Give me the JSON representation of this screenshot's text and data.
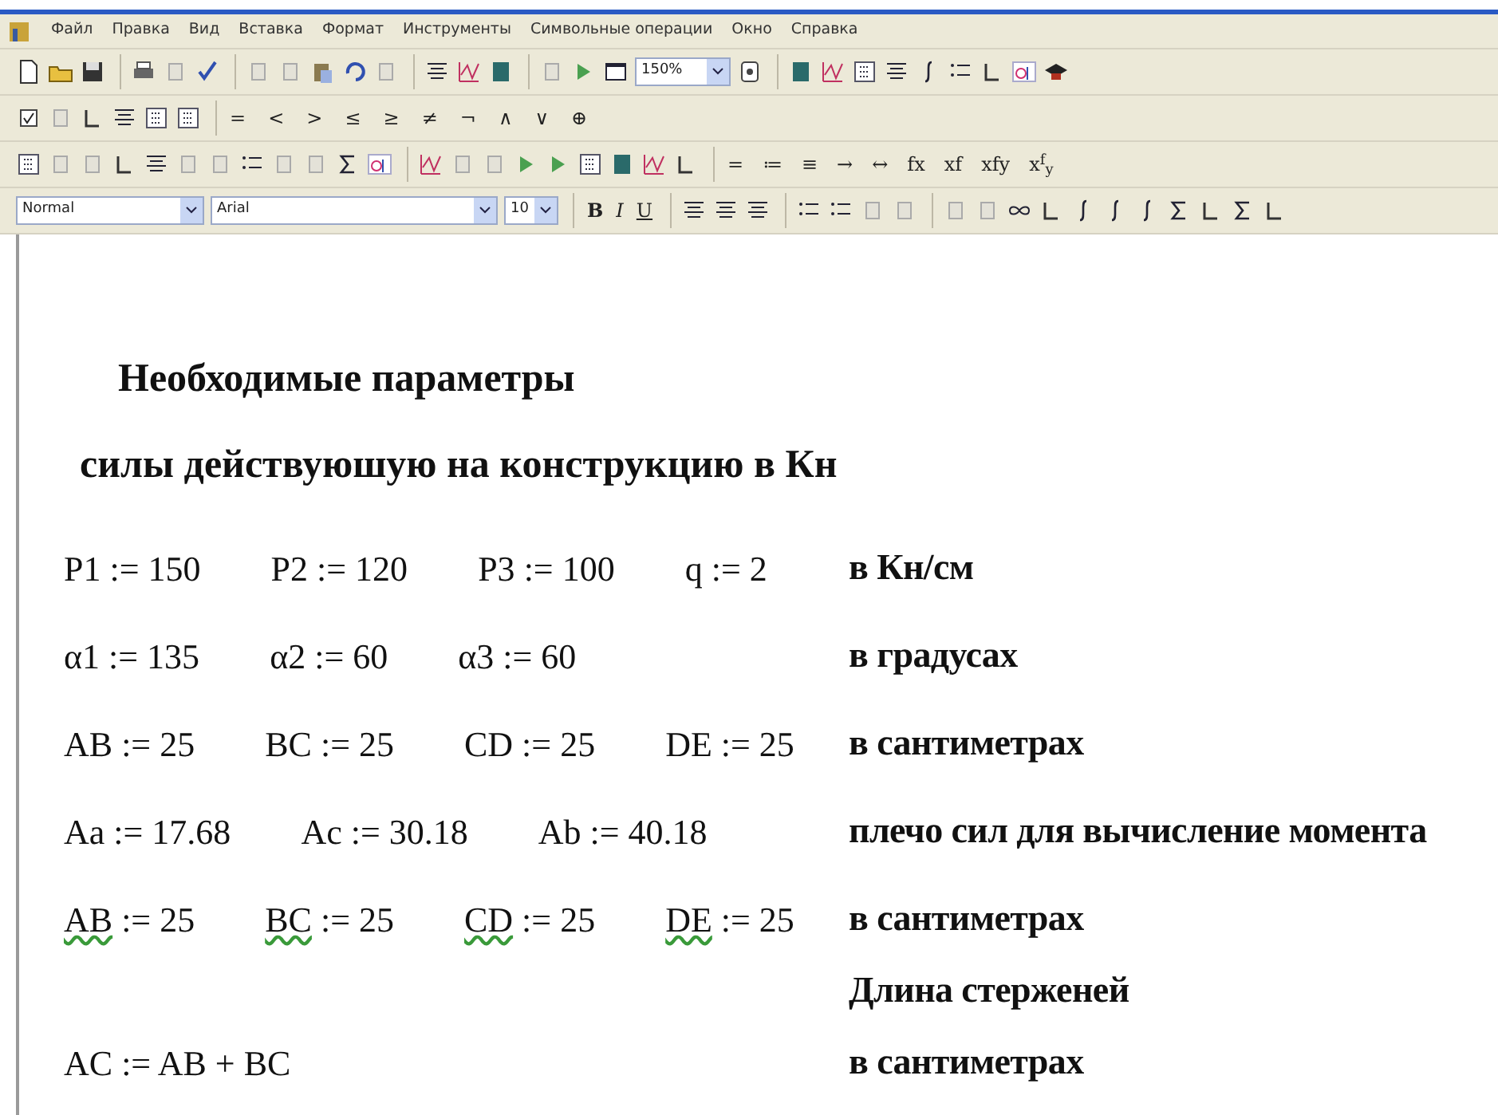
{
  "menu": [
    "Файл",
    "Правка",
    "Вид",
    "Вставка",
    "Формат",
    "Инструменты",
    "Символьные операции",
    "Окно",
    "Справка"
  ],
  "standard_toolbar": {
    "zoom": "150%"
  },
  "boolean_toolbar": [
    "=",
    "<",
    ">",
    "≤",
    "≥",
    "≠",
    "¬",
    "∧",
    "∨",
    "⊕"
  ],
  "evaluation_toolbar": [
    "=",
    "≔",
    "≡",
    "→",
    "↔",
    "fx",
    "xf",
    "xfy",
    "x$^{f}$$_{y}$"
  ],
  "formatting_toolbar": {
    "style": "Normal",
    "font": "Arial",
    "size": "10",
    "text_buttons": [
      "B",
      "I",
      "U"
    ]
  },
  "worksheet": {
    "headings": [
      "Необходимые параметры",
      "силы действуюшую на конструкцию в Кн"
    ],
    "lines": [
      {
        "defs": [
          {
            "name": "P1",
            "op": ":=",
            "value": "150",
            "flagged": false
          },
          {
            "name": "P2",
            "op": ":=",
            "value": "120",
            "flagged": false
          },
          {
            "name": "P3",
            "op": ":=",
            "value": "100",
            "flagged": false
          },
          {
            "name": "q",
            "op": ":=",
            "value": "2",
            "flagged": false
          }
        ],
        "note": "в Кн/см"
      },
      {
        "defs": [
          {
            "name": "α1",
            "op": ":=",
            "value": "135",
            "flagged": false
          },
          {
            "name": "α2",
            "op": ":=",
            "value": "60",
            "flagged": false
          },
          {
            "name": "α3",
            "op": ":=",
            "value": "60",
            "flagged": false
          }
        ],
        "note": "в градусах"
      },
      {
        "defs": [
          {
            "name": "AB",
            "op": ":=",
            "value": "25",
            "flagged": false
          },
          {
            "name": "BC",
            "op": ":=",
            "value": "25",
            "flagged": false
          },
          {
            "name": "CD",
            "op": ":=",
            "value": "25",
            "flagged": false
          },
          {
            "name": "DE",
            "op": ":=",
            "value": "25",
            "flagged": false
          }
        ],
        "note": "в сантиметрах"
      },
      {
        "defs": [
          {
            "name": "Aa",
            "op": ":=",
            "value": "17.68",
            "flagged": false
          },
          {
            "name": "Ac",
            "op": ":=",
            "value": "30.18",
            "flagged": false
          },
          {
            "name": "Ab",
            "op": ":=",
            "value": "40.18",
            "flagged": false
          }
        ],
        "note": "плечо сил для вычисление момента"
      },
      {
        "defs": [
          {
            "name": "AB",
            "op": ":=",
            "value": "25",
            "flagged": true
          },
          {
            "name": "BC",
            "op": ":=",
            "value": "25",
            "flagged": true
          },
          {
            "name": "CD",
            "op": ":=",
            "value": "25",
            "flagged": true
          },
          {
            "name": "DE",
            "op": ":=",
            "value": "25",
            "flagged": true
          }
        ],
        "note": "в сантиметрах"
      },
      {
        "note": "Длина стерженей"
      },
      {
        "defs": [
          {
            "name": "AC",
            "op": ":=",
            "value": "AB + BC",
            "flagged": false
          }
        ],
        "note": "в сантиметрах"
      }
    ]
  }
}
